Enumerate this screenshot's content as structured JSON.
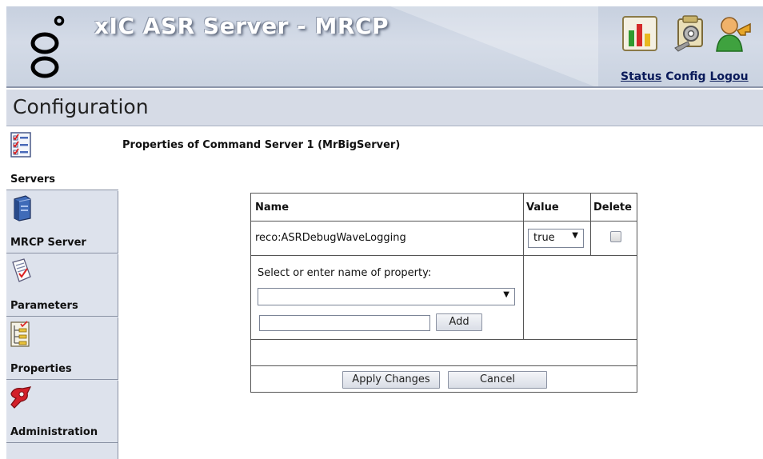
{
  "header": {
    "app_title": "xIC ASR Server - MRCP",
    "nav": {
      "status": "Status",
      "config": "Config",
      "logout": "Logou"
    },
    "icons": [
      "status-chart-icon",
      "config-gear-icon",
      "logout-user-icon"
    ]
  },
  "page": {
    "title": "Configuration",
    "section_heading": "Properties of Command Server 1 (MrBigServer)"
  },
  "sidebar": {
    "items": [
      {
        "label": "Servers",
        "icon": "servers-checklist-icon",
        "active": true
      },
      {
        "label": "MRCP Server",
        "icon": "server-box-icon",
        "active": false
      },
      {
        "label": "Parameters",
        "icon": "parameters-doc-icon",
        "active": false
      },
      {
        "label": "Properties",
        "icon": "properties-tree-icon",
        "active": false
      },
      {
        "label": "Administration",
        "icon": "administration-tools-icon",
        "active": false
      }
    ]
  },
  "table": {
    "headers": {
      "name": "Name",
      "value": "Value",
      "delete": "Delete"
    },
    "rows": [
      {
        "name": "reco:ASRDebugWaveLogging",
        "value": "true",
        "delete": false
      }
    ],
    "add_section": {
      "label": "Select or enter name of property:",
      "selected_value": "",
      "input_value": "",
      "add_button": "Add"
    },
    "buttons": {
      "apply": "Apply Changes",
      "cancel": "Cancel"
    }
  },
  "colors": {
    "header_bg": "#c7d0df",
    "title_bar_bg": "#d6dbe6",
    "sidebar_bg": "#dde2ec",
    "nav_link": "#0a1a5a"
  }
}
